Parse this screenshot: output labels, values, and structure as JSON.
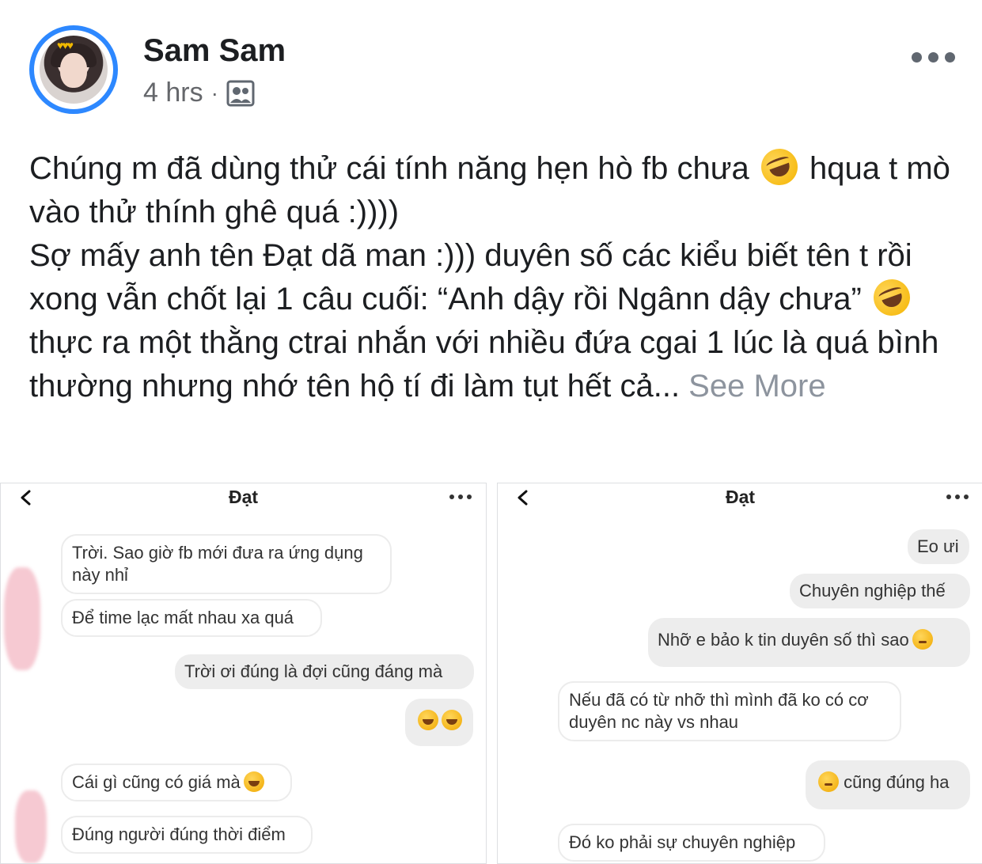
{
  "post": {
    "author": "Sam Sam",
    "time": "4 hrs",
    "separator": "·",
    "audience_icon": "group-audience-icon",
    "text_parts": {
      "p1a": "Chúng m đã dùng thử cái tính năng hẹn hò fb chưa",
      "p1b": " hqua t mò vào thử thính ghê quá :))))",
      "p2": "Sợ mấy anh tên Đạt dã man :))) duyên số các kiểu biết tên t rồi xong vẫn chốt lại 1 câu cuối: “Anh dậy rồi Ngânn dậy chưa”",
      "p3": " thực ra một thằng ctrai nhắn với nhiều đứa cgai 1 lúc là quá bình thường nhưng nhớ tên hộ tí đi làm tụt hết cả...",
      "see_more": " See More"
    }
  },
  "left_chat": {
    "title": "Đạt",
    "messages": [
      {
        "dir": "in",
        "text": "Trời. Sao giờ fb mới đưa ra ứng dụng này nhỉ"
      },
      {
        "dir": "in",
        "text": "Để time lạc mất nhau xa quá"
      },
      {
        "dir": "out",
        "text": "Trời ơi đúng là đợi cũng đáng mà"
      },
      {
        "dir": "out",
        "text": ""
      },
      {
        "dir": "in",
        "text": "Cái gì cũng có giá mà"
      },
      {
        "dir": "in",
        "text": "Đúng người đúng thời điểm"
      }
    ]
  },
  "right_chat": {
    "title": "Đạt",
    "messages": [
      {
        "dir": "out",
        "text": "Eo ưi"
      },
      {
        "dir": "out",
        "text": "Chuyên nghiệp thế"
      },
      {
        "dir": "out",
        "text": "Nhỡ e bảo k tin duyên số thì sao"
      },
      {
        "dir": "in",
        "text": "Nếu đã có từ nhỡ thì mình đã ko có cơ duyên nc này vs nhau"
      },
      {
        "dir": "out",
        "text": " cũng đúng ha"
      },
      {
        "dir": "in",
        "text": "Đó ko phải sự chuyên nghiệp"
      }
    ]
  }
}
